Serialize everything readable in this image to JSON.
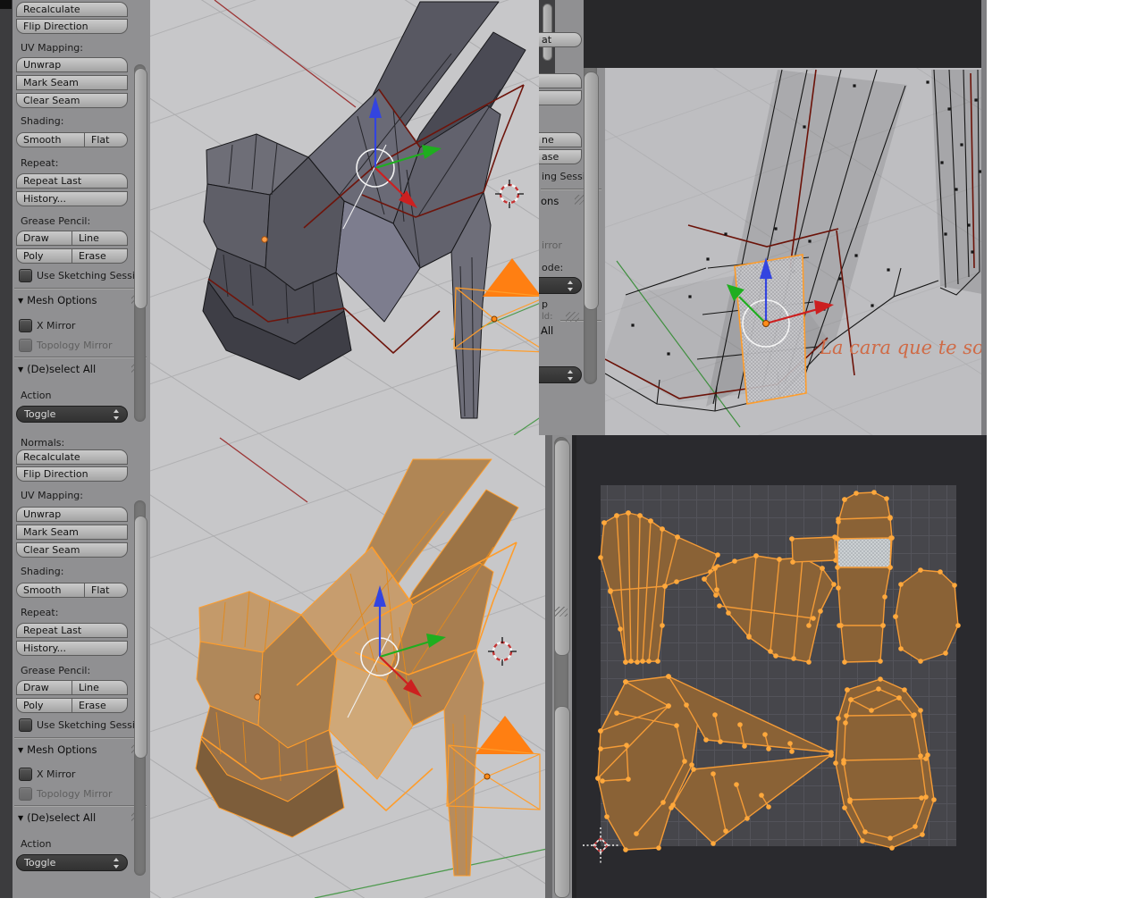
{
  "colors": {
    "selection_orange": "#ff9d2b",
    "seam_red": "#6e150c",
    "uv_island_fill": "#8a6236",
    "annotation_orange": "#cf6b47",
    "axis_red": "#9c3535",
    "axis_green": "#4e9a4e",
    "viewport_gray": "#c7c7c9",
    "uv_background": "#2a2a2e"
  },
  "panels": {
    "normals_label": "Normals:",
    "recalculate": "Recalculate",
    "flip_direction": "Flip Direction",
    "uv_mapping_label": "UV Mapping:",
    "unwrap": "Unwrap",
    "mark_seam": "Mark Seam",
    "clear_seam": "Clear Seam",
    "shading_label": "Shading:",
    "smooth": "Smooth",
    "flat": "Flat",
    "repeat_label": "Repeat:",
    "repeat_last": "Repeat Last",
    "history": "History...",
    "grease_pencil_label": "Grease Pencil:",
    "draw": "Draw",
    "line": "Line",
    "poly": "Poly",
    "erase": "Erase",
    "use_sketching": "Use Sketching Sessi",
    "mesh_options_header": "Mesh Options",
    "x_mirror": "X Mirror",
    "topology_mirror": "Topology Mirror",
    "deselect_header": "(De)select All",
    "action_label": "Action",
    "action_value": "Toggle"
  },
  "strip_fragments": {
    "flat_frag": "at",
    "line_frag": "ne",
    "erase_frag": "ase",
    "sketching_frag": "ing Sessi",
    "options_frag": "ons",
    "mirror_frag": "irror",
    "mode_frag": "ode:",
    "p_frag": "p",
    "ld_frag": "ld:",
    "all_frag": "All"
  },
  "annotation": {
    "text": "La cara que te sobra"
  }
}
